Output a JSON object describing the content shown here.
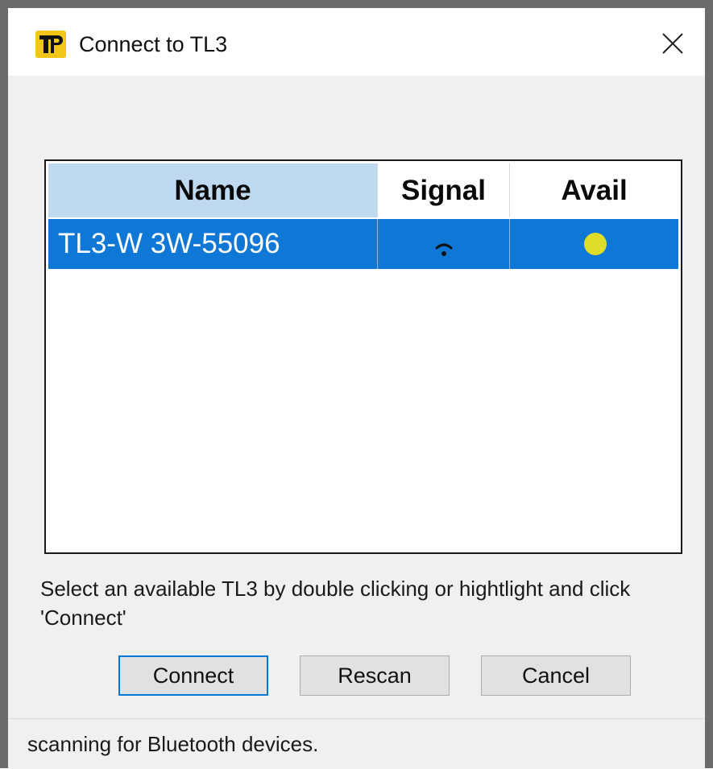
{
  "window": {
    "title": "Connect to TL3",
    "icon": "tp-app-icon",
    "close_icon": "close-icon"
  },
  "device_list": {
    "columns": [
      "Name",
      "Signal",
      "Avail"
    ],
    "rows": [
      {
        "name": "TL3-W 3W-55096",
        "signal_icon": "wifi-signal-weak-icon",
        "avail_icon": "available-dot-icon",
        "avail_color": "#dede2a",
        "selected": true
      }
    ]
  },
  "instructions": "Select an available TL3 by double clicking or hightlight and click 'Connect'",
  "buttons": {
    "connect": "Connect",
    "rescan": "Rescan",
    "cancel": "Cancel"
  },
  "status_bar": {
    "text": "scanning for Bluetooth devices."
  },
  "colors": {
    "selection": "#0f78d7",
    "header_sorted": "#bed9f0",
    "default_button_border": "#0078d7",
    "icon_background": "#f2c618"
  }
}
